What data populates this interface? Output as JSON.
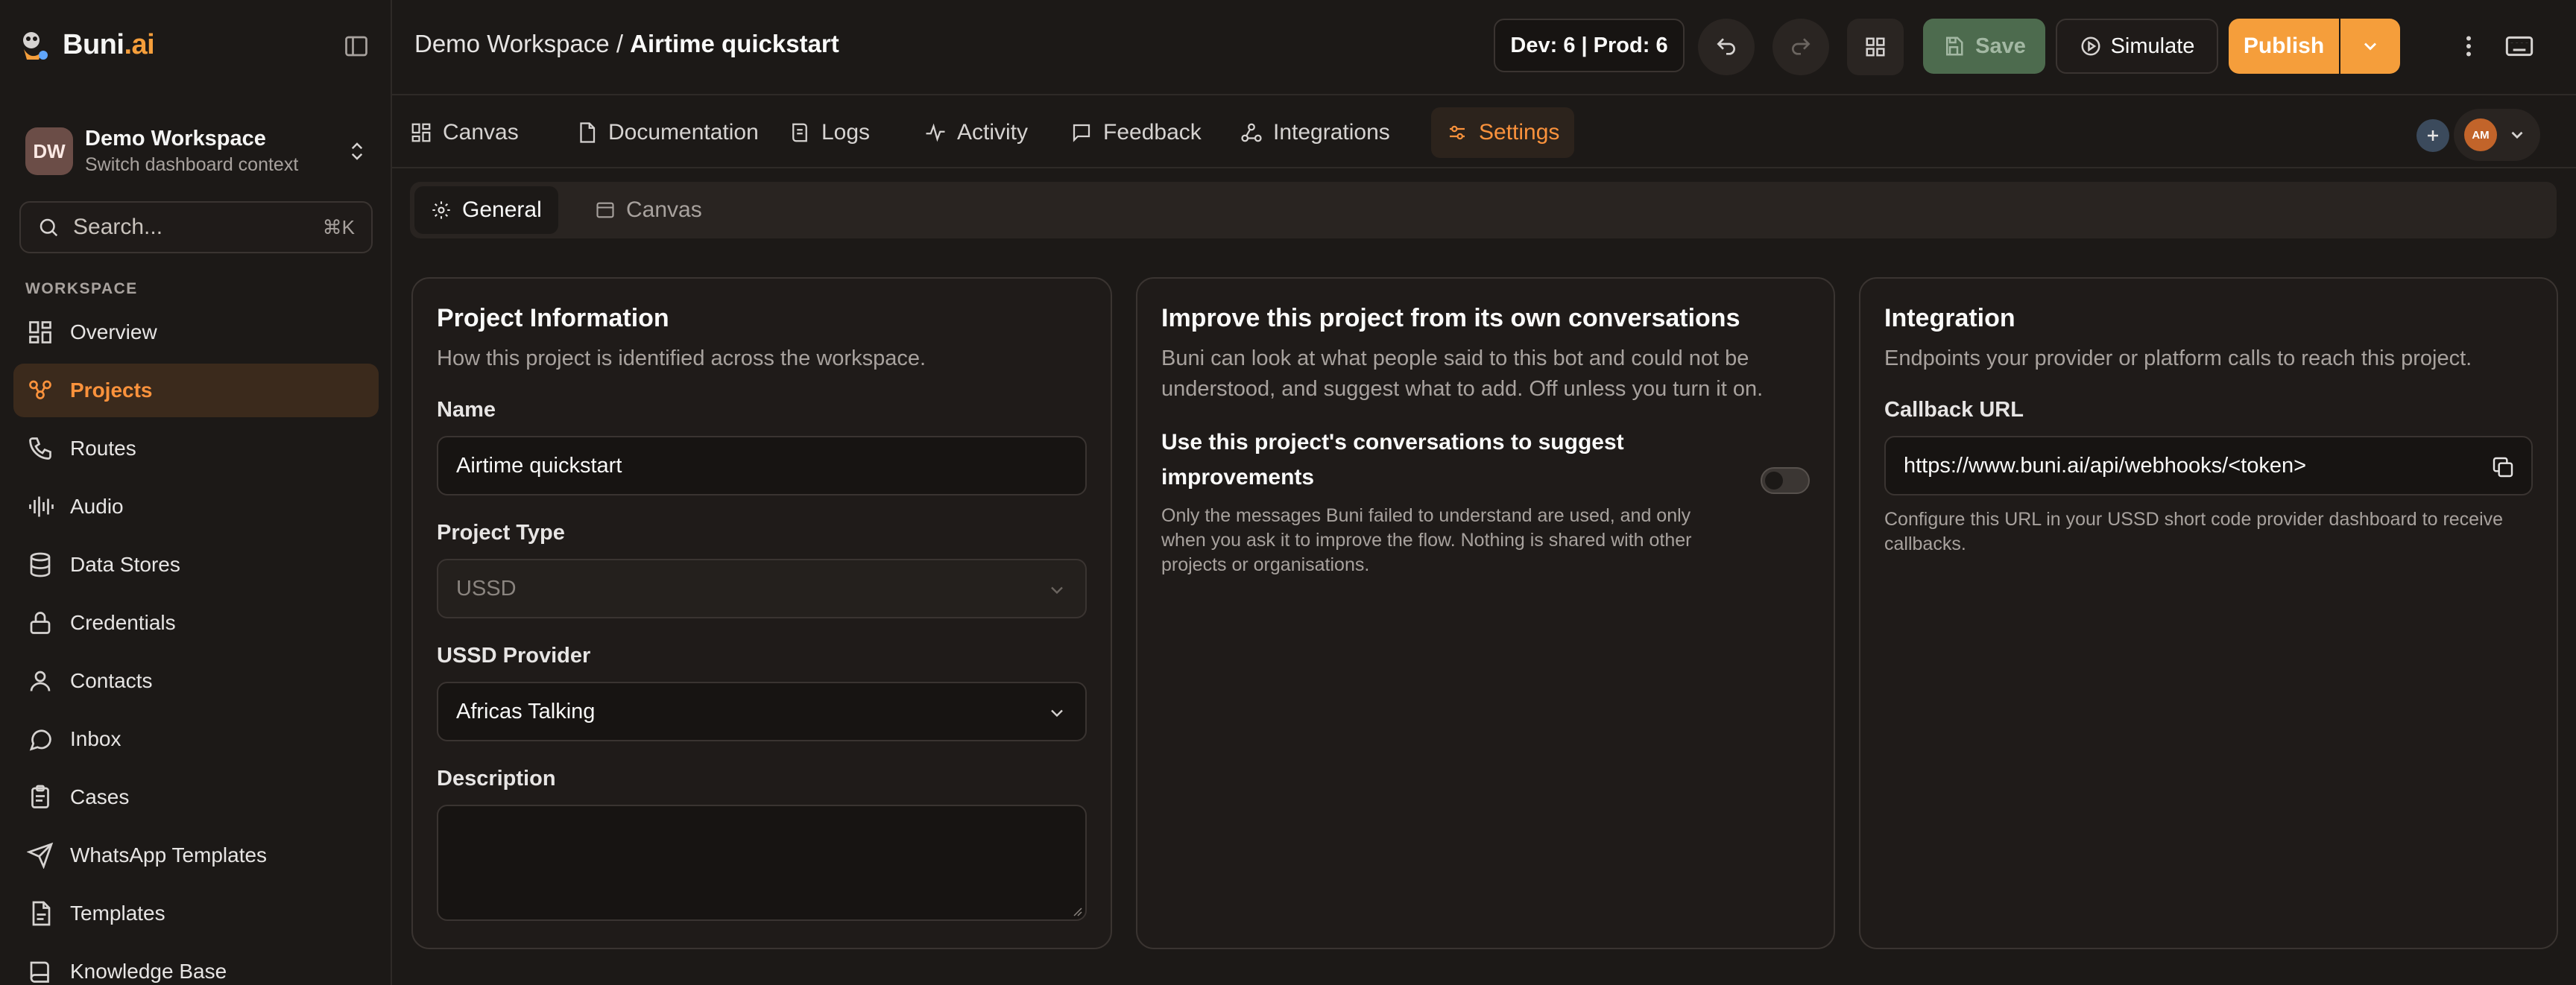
{
  "app": {
    "brand_main": "Buni",
    "brand_accent": ".ai",
    "accent_color": "#f59e3b"
  },
  "workspace": {
    "initials": "DW",
    "name": "Demo Workspace",
    "subtitle": "Switch dashboard context"
  },
  "search": {
    "placeholder": "Search...",
    "shortcut": "⌘K"
  },
  "sidebar": {
    "section_label": "WORKSPACE",
    "items": [
      {
        "label": "Overview",
        "icon": "grid-icon",
        "active": false
      },
      {
        "label": "Projects",
        "icon": "people-icon",
        "active": true
      },
      {
        "label": "Routes",
        "icon": "phone-icon",
        "active": false
      },
      {
        "label": "Audio",
        "icon": "audio-wave-icon",
        "active": false
      },
      {
        "label": "Data Stores",
        "icon": "database-icon",
        "active": false
      },
      {
        "label": "Credentials",
        "icon": "lock-icon",
        "active": false
      },
      {
        "label": "Contacts",
        "icon": "user-icon",
        "active": false
      },
      {
        "label": "Inbox",
        "icon": "chat-bubble-icon",
        "active": false
      },
      {
        "label": "Cases",
        "icon": "clipboard-icon",
        "active": false
      },
      {
        "label": "WhatsApp Templates",
        "icon": "send-icon",
        "active": false
      },
      {
        "label": "Templates",
        "icon": "document-icon",
        "active": false
      },
      {
        "label": "Knowledge Base",
        "icon": "book-icon",
        "active": false
      }
    ]
  },
  "header": {
    "breadcrumb_workspace": "Demo Workspace",
    "breadcrumb_separator": " / ",
    "breadcrumb_project": "Airtime quickstart",
    "env_badge": "Dev: 6 | Prod: 6",
    "save_label": "Save",
    "simulate_label": "Simulate",
    "publish_label": "Publish"
  },
  "tabs": [
    {
      "label": "Canvas",
      "icon": "grid-icon",
      "active": false
    },
    {
      "label": "Documentation",
      "icon": "document-icon",
      "active": false
    },
    {
      "label": "Logs",
      "icon": "log-icon",
      "active": false
    },
    {
      "label": "Activity",
      "icon": "activity-icon",
      "active": false
    },
    {
      "label": "Feedback",
      "icon": "chat-bubble-icon",
      "active": false
    },
    {
      "label": "Integrations",
      "icon": "webhook-icon",
      "active": false
    },
    {
      "label": "Settings",
      "icon": "sliders-icon",
      "active": true
    }
  ],
  "user": {
    "initials": "AM"
  },
  "subtabs": [
    {
      "label": "General",
      "icon": "gear-icon",
      "active": true
    },
    {
      "label": "Canvas",
      "icon": "layout-icon",
      "active": false
    }
  ],
  "project_info": {
    "title": "Project Information",
    "description": "How this project is identified across the workspace.",
    "name_label": "Name",
    "name_value": "Airtime quickstart",
    "type_label": "Project Type",
    "type_value": "USSD",
    "provider_label": "USSD Provider",
    "provider_value": "Africas Talking",
    "description_label": "Description",
    "description_value": ""
  },
  "improve": {
    "title": "Improve this project from its own conversations",
    "description": "Buni can look at what people said to this bot and could not be understood, and suggest what to add. Off unless you turn it on.",
    "toggle_title": "Use this project's conversations to suggest improvements",
    "toggle_description": "Only the messages Buni failed to understand are used, and only when you ask it to improve the flow. Nothing is shared with other projects or organisations.",
    "enabled": false
  },
  "integration": {
    "title": "Integration",
    "description": "Endpoints your provider or platform calls to reach this project.",
    "callback_label": "Callback URL",
    "callback_value": "https://www.buni.ai/api/webhooks/<token>",
    "helper": "Configure this URL in your USSD short code provider dashboard to receive callbacks."
  }
}
